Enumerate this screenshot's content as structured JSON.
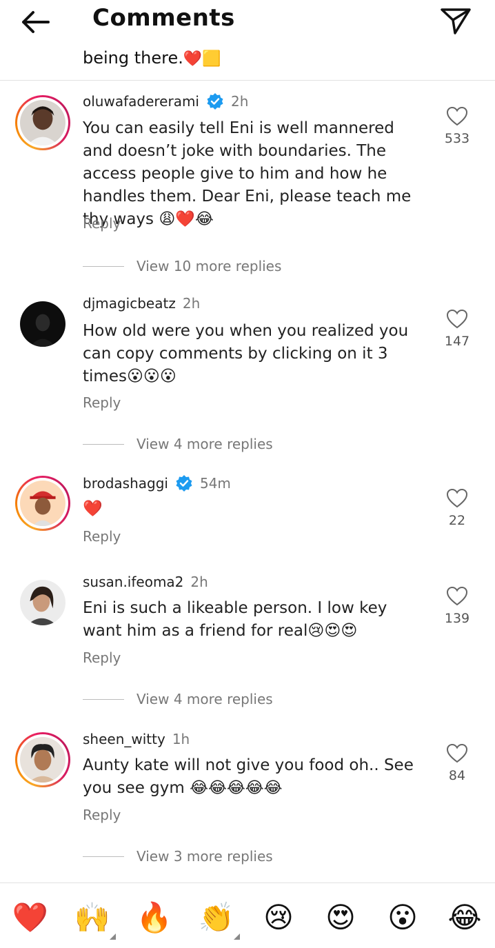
{
  "header": {
    "title": "Comments",
    "back_icon": "arrow-left-icon",
    "send_icon": "paper-plane-icon"
  },
  "top_fragment": {
    "text": "being there.",
    "emojis": "❤️🟨"
  },
  "comments": [
    {
      "username": "oluwafadererami",
      "verified": true,
      "time": "2h",
      "text": "You can easily tell Eni is well mannered and doesn’t joke with boundaries. The access people give to him and how he handles them. Dear Eni, please teach me thy ways 😩❤️😂",
      "reply_label": "Reply",
      "likes": "533",
      "view_more": "View 10 more replies"
    },
    {
      "username": "djmagicbeatz",
      "verified": false,
      "time": "2h",
      "text": "How old were you when you realized you can copy comments by clicking on it 3 times😮😮😮",
      "reply_label": "Reply",
      "likes": "147",
      "view_more": "View 4 more replies"
    },
    {
      "username": "brodashaggi",
      "verified": true,
      "time": "54m",
      "text": "❤️",
      "reply_label": "Reply",
      "likes": "22",
      "view_more": ""
    },
    {
      "username": "susan.ifeoma2",
      "verified": false,
      "time": "2h",
      "text": "Eni is such a likeable person. I low key want him as a friend for real😢😍😍",
      "reply_label": "Reply",
      "likes": "139",
      "view_more": "View 4 more replies"
    },
    {
      "username": "sheen_witty",
      "verified": false,
      "time": "1h",
      "text": "Aunty kate will not give you food oh.. See you see gym 😂😂😂😂😂",
      "reply_label": "Reply",
      "likes": "84",
      "view_more": "View 3 more replies"
    }
  ],
  "emoji_bar": {
    "items": [
      "❤️",
      "🙌",
      "🔥",
      "👏",
      "😢",
      "😍",
      "😮",
      "😂"
    ]
  },
  "colors": {
    "verified_blue": "#1d9bf0",
    "heart_red": "#e0203a",
    "story_ring_orange": "#f57c00",
    "story_ring_pink": "#e91e63"
  }
}
